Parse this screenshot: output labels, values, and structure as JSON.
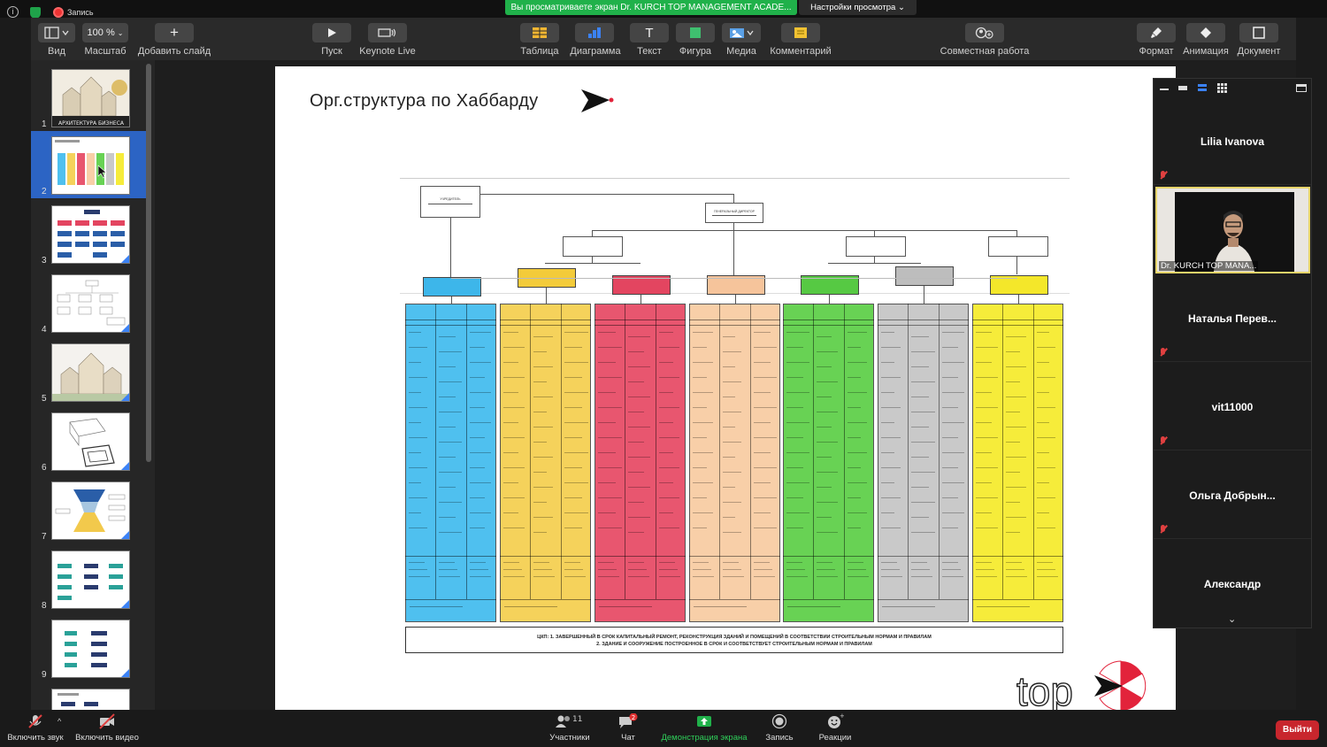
{
  "zoom_top": {
    "info_icon": "i",
    "recording_label": "Запись",
    "share_banner": "Вы просматриваете экран Dr. KURCH TOP MANAGEMENT ACADE...",
    "view_settings": "Настройки просмотра ⌄"
  },
  "toolbar": {
    "view_label": "Вид",
    "zoom_value": "100 %",
    "zoom_label": "Масштаб",
    "add_slide_label": "Добавить слайд",
    "play_label": "Пуск",
    "keynote_live_label": "Keynote Live",
    "table_label": "Таблица",
    "chart_label": "Диаграмма",
    "text_label": "Текст",
    "shape_label": "Фигура",
    "media_label": "Медиа",
    "comment_label": "Комментарий",
    "collaborate_label": "Совместная работа",
    "format_label": "Формат",
    "animate_label": "Анимация",
    "document_label": "Документ"
  },
  "navigator": {
    "slides": [
      {
        "num": "1",
        "caption": "АРХИТЕКТУРА БИЗНЕСА"
      },
      {
        "num": "2",
        "caption": ""
      },
      {
        "num": "3",
        "caption": ""
      },
      {
        "num": "4",
        "caption": ""
      },
      {
        "num": "5",
        "caption": ""
      },
      {
        "num": "6",
        "caption": ""
      },
      {
        "num": "7",
        "caption": ""
      },
      {
        "num": "8",
        "caption": ""
      },
      {
        "num": "9",
        "caption": ""
      }
    ],
    "selected": "2"
  },
  "slide": {
    "title": "Орг.структура по Хаббарду",
    "founder_box": "УЧРЕДИТЕЛЬ",
    "gd_box": "ГЕНЕРАЛЬНЫЙ ДИРЕКТОР",
    "footer_line1": "ЦКП: 1. ЗАВЕРШЕННЫЙ В СРОК КАПИТАЛЬНЫЙ РЕМОНТ, РЕКОНСТРУКЦИЯ ЗДАНИЙ И ПОМЕЩЕНИЙ В СООТВЕТСТВИИ СТРОИТЕЛЬНЫМ НОРМАМ И ПРАВИЛАМ",
    "footer_line2": "2. ЗДАНИЕ И СООРУЖЕНИЕ ПОСТРОЕННОЕ В СРОК И СООТВЕТСТВУЕТ СТРОИТЕЛЬНЫМ НОРМАМ И ПРАВИЛАМ",
    "logo_text": "top",
    "divisions": [
      {
        "color": "#4fc0ef",
        "head_color": "#3db6ea"
      },
      {
        "color": "#f5d25b",
        "head_color": "#f3cb3a"
      },
      {
        "color": "#e8566f",
        "head_color": "#e34560"
      },
      {
        "color": "#f8cfa8",
        "head_color": "#f6c49b"
      },
      {
        "color": "#68d254",
        "head_color": "#56c943"
      },
      {
        "color": "#c9c9c9",
        "head_color": "#bdbdbd"
      },
      {
        "color": "#f6ec3a",
        "head_color": "#f4e72a"
      }
    ]
  },
  "participants": {
    "names": [
      "Lilia Ivanova",
      "Наталья  Перев...",
      "vit11000",
      "Ольга  Добрын...",
      "Александр"
    ],
    "video_label": "Dr. KURCH TOP MANA..."
  },
  "bottom": {
    "unmute_label": "Включить звук",
    "video_label": "Включить видео",
    "participants_label": "Участники",
    "participants_count": "11",
    "chat_label": "Чат",
    "chat_badge": "2",
    "share_label": "Демонстрация экрана",
    "record_label": "Запись",
    "reactions_label": "Реакции",
    "leave_label": "Выйти"
  },
  "colors": {
    "share_green": "#20b14a",
    "selection_blue": "#2c64c4",
    "leave_red": "#c8262d"
  }
}
